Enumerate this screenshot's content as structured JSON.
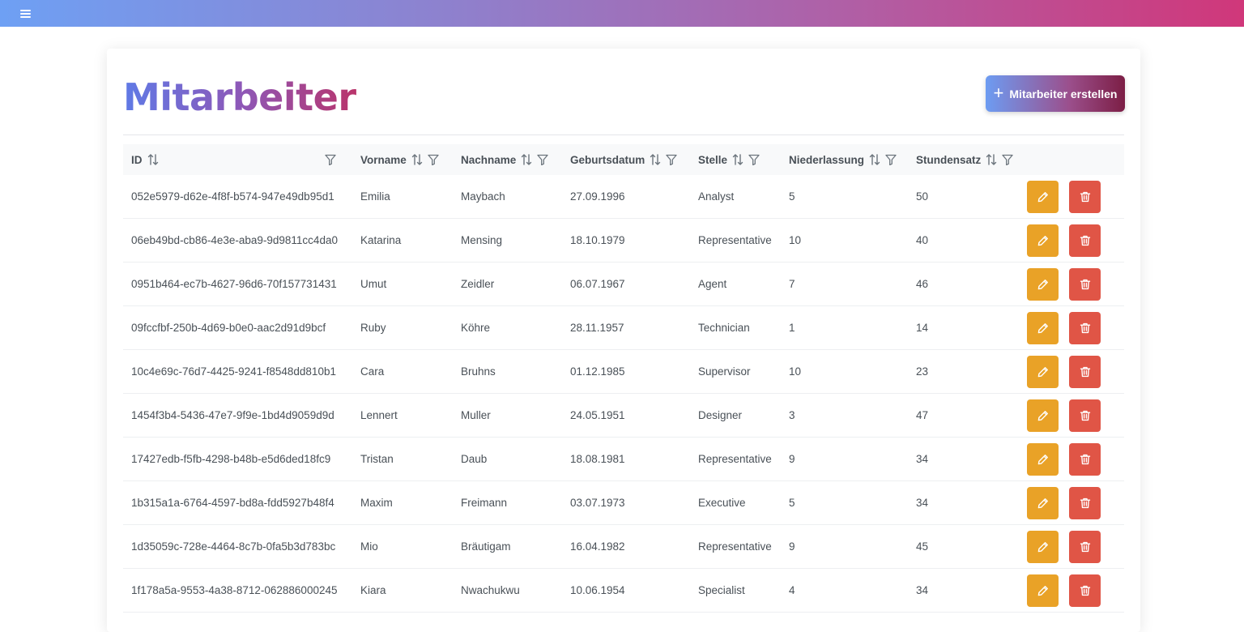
{
  "page": {
    "title": "Mitarbeiter",
    "create_button_label": "Mitarbeiter erstellen"
  },
  "colors": {
    "edit": "#e9a227",
    "delete": "#e05546",
    "header_bg": "#f8f9fa"
  },
  "icons": {
    "menu": "menu-icon",
    "sort": "sort-icon",
    "filter": "filter-icon",
    "edit": "pencil-icon",
    "delete": "trash-icon",
    "plus": "plus-icon"
  },
  "table": {
    "columns": [
      "ID",
      "Vorname",
      "Nachname",
      "Geburtsdatum",
      "Stelle",
      "Niederlassung",
      "Stundensatz"
    ],
    "rows": [
      [
        "052e5979-d62e-4f8f-b574-947e49db95d1",
        "Emilia",
        "Maybach",
        "27.09.1996",
        "Analyst",
        "5",
        "50"
      ],
      [
        "06eb49bd-cb86-4e3e-aba9-9d9811cc4da0",
        "Katarina",
        "Mensing",
        "18.10.1979",
        "Representative",
        "10",
        "40"
      ],
      [
        "0951b464-ec7b-4627-96d6-70f157731431",
        "Umut",
        "Zeidler",
        "06.07.1967",
        "Agent",
        "7",
        "46"
      ],
      [
        "09fccfbf-250b-4d69-b0e0-aac2d91d9bcf",
        "Ruby",
        "Köhre",
        "28.11.1957",
        "Technician",
        "1",
        "14"
      ],
      [
        "10c4e69c-76d7-4425-9241-f8548dd810b1",
        "Cara",
        "Bruhns",
        "01.12.1985",
        "Supervisor",
        "10",
        "23"
      ],
      [
        "1454f3b4-5436-47e7-9f9e-1bd4d9059d9d",
        "Lennert",
        "Muller",
        "24.05.1951",
        "Designer",
        "3",
        "47"
      ],
      [
        "17427edb-f5fb-4298-b48b-e5d6ded18fc9",
        "Tristan",
        "Daub",
        "18.08.1981",
        "Representative",
        "9",
        "34"
      ],
      [
        "1b315a1a-6764-4597-bd8a-fdd5927b48f4",
        "Maxim",
        "Freimann",
        "03.07.1973",
        "Executive",
        "5",
        "34"
      ],
      [
        "1d35059c-728e-4464-8c7b-0fa5b3d783bc",
        "Mio",
        "Bräutigam",
        "16.04.1982",
        "Representative",
        "9",
        "45"
      ],
      [
        "1f178a5a-9553-4a38-8712-062886000245",
        "Kiara",
        "Nwachukwu",
        "10.06.1954",
        "Specialist",
        "4",
        "34"
      ]
    ]
  }
}
